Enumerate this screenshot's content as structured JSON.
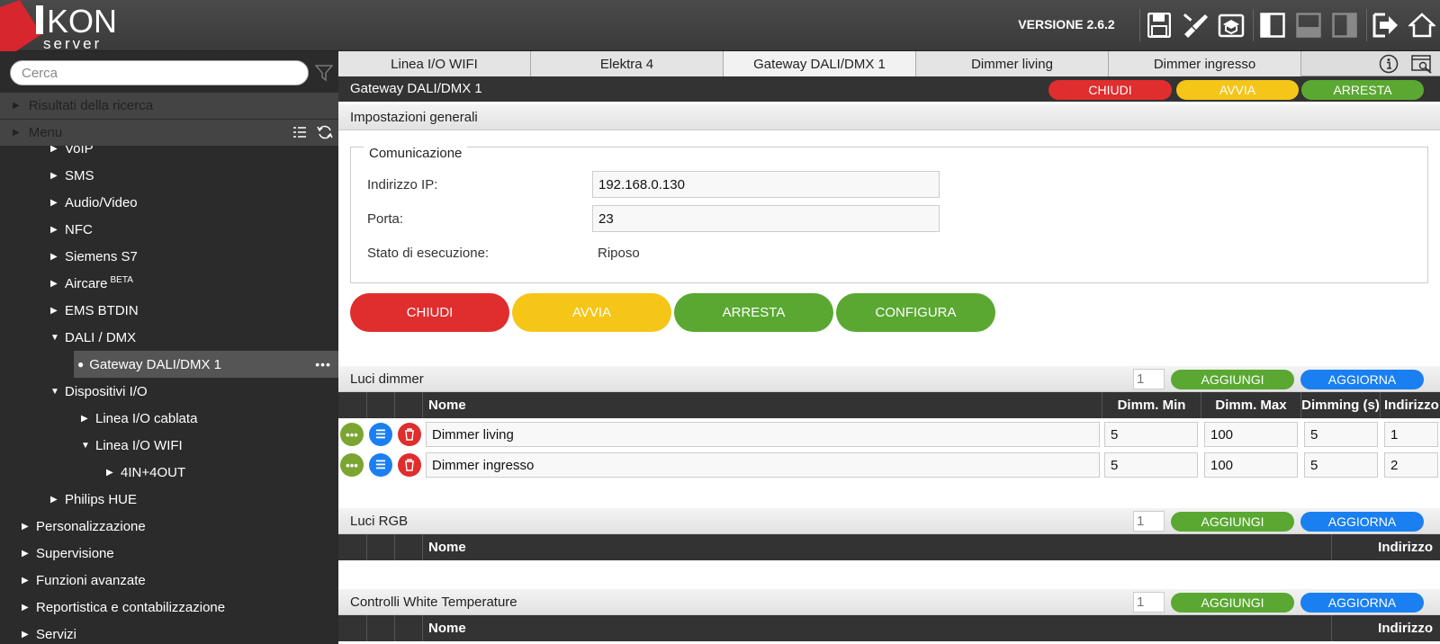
{
  "app": {
    "logo_main": "KON",
    "logo_sub": "server",
    "version": "VERSIONE 2.6.2"
  },
  "toolbar": {
    "icons": [
      "save-icon",
      "brush-icon",
      "education-icon",
      "layout-left-icon",
      "layout-bottom-icon",
      "layout-right-icon",
      "logout-icon",
      "home-icon"
    ]
  },
  "sidebar": {
    "search_placeholder": "Cerca",
    "results_label": "Risultati della ricerca",
    "menu_label": "Menu",
    "items": [
      {
        "label": "VoIP"
      },
      {
        "label": "SMS"
      },
      {
        "label": "Audio/Video"
      },
      {
        "label": "NFC"
      },
      {
        "label": "Siemens S7"
      },
      {
        "label": "Aircare",
        "sup": "BETA"
      },
      {
        "label": "EMS BTDIN"
      },
      {
        "label": "DALI / DMX"
      },
      {
        "label": "Gateway DALI/DMX 1"
      },
      {
        "label": "Dispositivi I/O"
      },
      {
        "label": "Linea I/O cablata"
      },
      {
        "label": "Linea I/O WIFI"
      },
      {
        "label": "4IN+4OUT"
      },
      {
        "label": "Philips HUE"
      },
      {
        "label": "Personalizzazione"
      },
      {
        "label": "Supervisione"
      },
      {
        "label": "Funzioni avanzate"
      },
      {
        "label": "Reportistica e contabilizzazione"
      },
      {
        "label": "Servizi"
      }
    ]
  },
  "tabs": [
    "Linea I/O WIFI",
    "Elektra 4",
    "Gateway DALI/DMX 1",
    "Dimmer living",
    "Dimmer ingresso"
  ],
  "panel": {
    "title": "Gateway DALI/DMX 1",
    "btn_close": "CHIUDI",
    "btn_start": "AVVIA",
    "btn_stop": "ARRESTA",
    "btn_config": "CONFIGURA",
    "general_settings": "Impostazioni generali",
    "communication": "Comunicazione",
    "ip_label": "Indirizzo IP:",
    "ip_value": "192.168.0.130",
    "port_label": "Porta:",
    "port_value": "23",
    "state_label": "Stato di esecuzione:",
    "state_value": "Riposo"
  },
  "sections": {
    "add": "AGGIUNGI",
    "refresh": "AGGIORNA",
    "count_placeholder": "1",
    "dimmer": {
      "title": "Luci dimmer",
      "columns": [
        "Nome",
        "Dimm. Min",
        "Dimm. Max",
        "Dimming (s)",
        "Indirizzo"
      ],
      "rows": [
        {
          "name": "Dimmer living",
          "min": "5",
          "max": "100",
          "dim": "5",
          "addr": "1"
        },
        {
          "name": "Dimmer ingresso",
          "min": "5",
          "max": "100",
          "dim": "5",
          "addr": "2"
        }
      ]
    },
    "rgb": {
      "title": "Luci RGB",
      "columns": [
        "Nome",
        "Indirizzo"
      ]
    },
    "white": {
      "title": "Controlli White Temperature",
      "columns": [
        "Nome",
        "Indirizzo"
      ]
    }
  },
  "colors": {
    "red": "#e02d2d",
    "yellow": "#f5c518",
    "green": "#5aa832",
    "blue": "#1a7ff0",
    "dark": "#2b2b2b"
  }
}
